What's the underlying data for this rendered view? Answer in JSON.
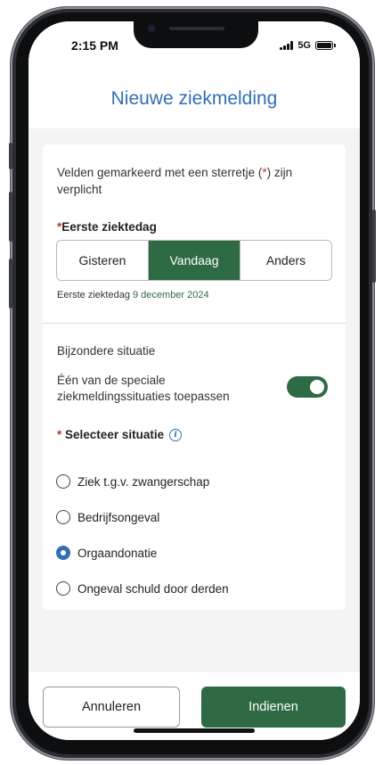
{
  "status_bar": {
    "time": "2:15 PM",
    "network": "5G",
    "battery_percent": 100,
    "signal_bars": 4
  },
  "header": {
    "title": "Nieuwe ziekmelding"
  },
  "form": {
    "required_note_before": "Velden gemarkeerd met een sterretje (",
    "required_note_star": "*",
    "required_note_after": ") zijn verplicht",
    "first_day": {
      "star": "*",
      "label": "Eerste ziektedag",
      "options": [
        "Gisteren",
        "Vandaag",
        "Anders"
      ],
      "selected_index": 1,
      "summary_prefix": "Eerste ziektedag",
      "summary_date": "9 december 2024"
    },
    "special": {
      "section_title": "Bijzondere situatie",
      "toggle_label": "Één van de speciale ziekmeldingssituaties toepassen",
      "toggle_on": true
    },
    "situation": {
      "star": "*",
      "label": "Selecteer situatie",
      "info_icon": "info-icon",
      "options": [
        "Ziek t.g.v. zwangerschap",
        "Bedrijfsongeval",
        "Orgaandonatie",
        "Ongeval schuld door derden"
      ],
      "selected_index": 2
    }
  },
  "footer": {
    "cancel_label": "Annuleren",
    "submit_label": "Indienen"
  },
  "colors": {
    "primary_green": "#2e6b45",
    "title_blue": "#2f6fb5",
    "required_red": "#c0392b"
  }
}
